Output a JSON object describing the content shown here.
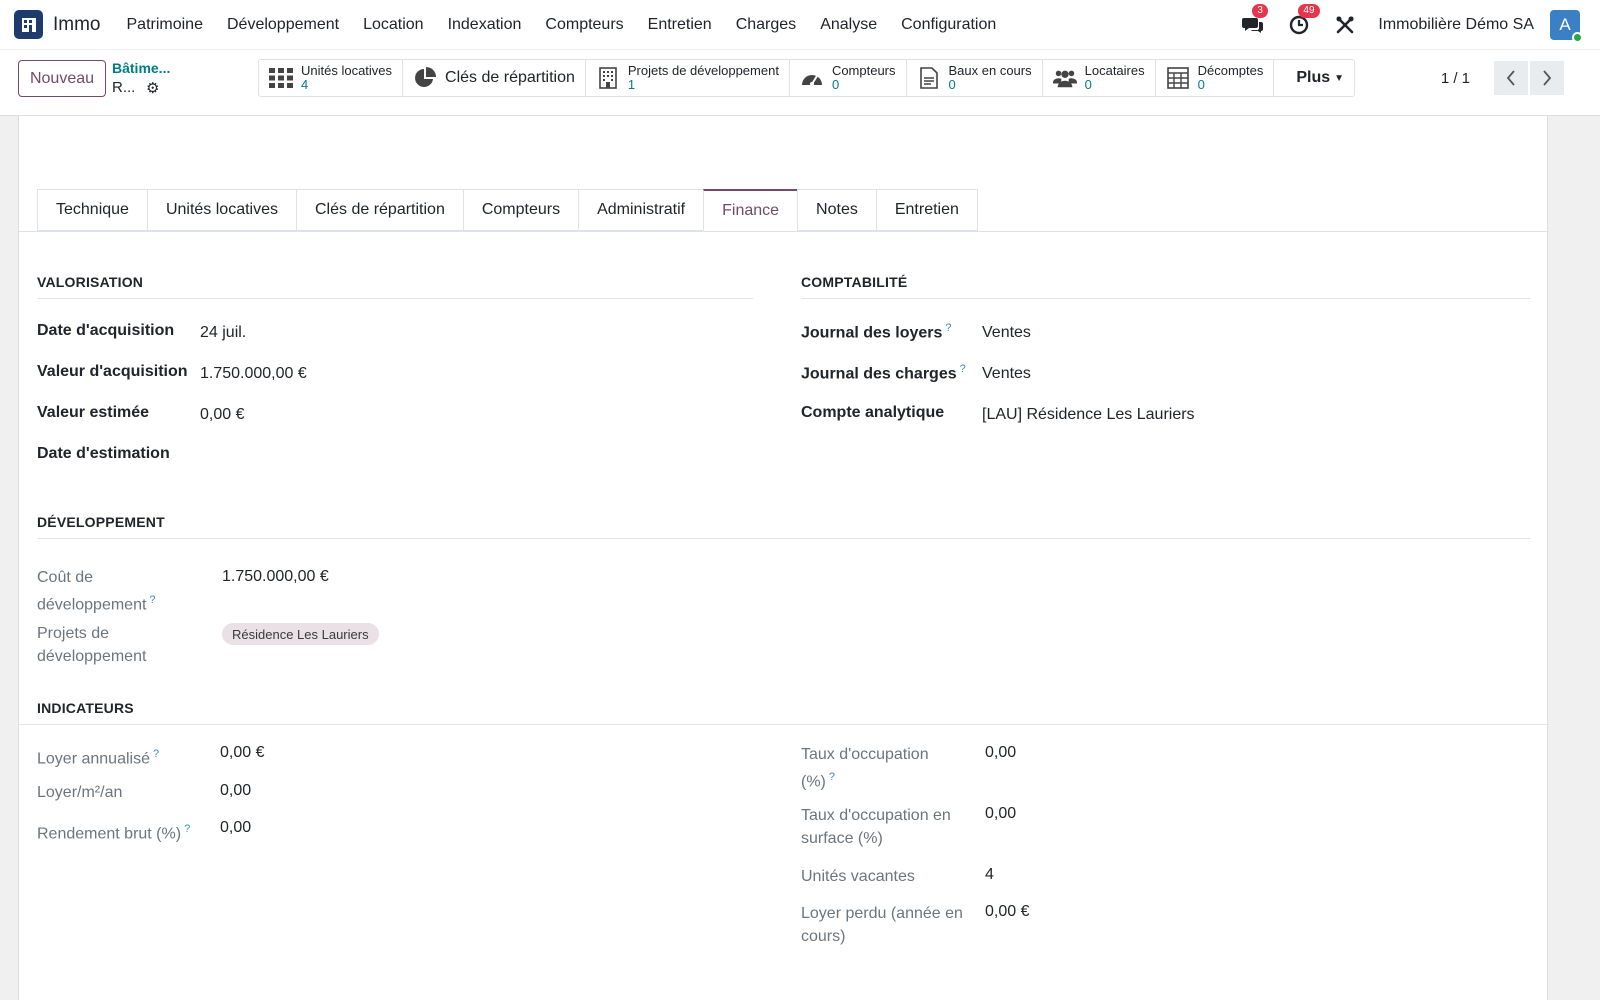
{
  "navbar": {
    "app_name": "Immo",
    "menu": [
      "Patrimoine",
      "Développement",
      "Location",
      "Indexation",
      "Compteurs",
      "Entretien",
      "Charges",
      "Analyse",
      "Configuration"
    ],
    "messages_count": "3",
    "activities_count": "49",
    "company": "Immobilière Démo SA",
    "avatar_letter": "A"
  },
  "control": {
    "new_label": "Nouveau",
    "breadcrumb_parent": "Bâtime...",
    "breadcrumb_current": "R...",
    "pager": "1 / 1",
    "smart_buttons": [
      {
        "label": "Unités locatives",
        "value": "4",
        "icon": "grid-icon"
      },
      {
        "label": "Clés de répartition",
        "value": null,
        "icon": "pie-chart-icon"
      },
      {
        "label": "Projets de développement",
        "value": "1",
        "icon": "building-icon"
      },
      {
        "label": "Compteurs",
        "value": "0",
        "icon": "gauge-icon"
      },
      {
        "label": "Baux en cours",
        "value": "0",
        "icon": "document-icon"
      },
      {
        "label": "Locataires",
        "value": "0",
        "icon": "users-icon"
      },
      {
        "label": "Décomptes",
        "value": "0",
        "icon": "calculator-icon"
      }
    ],
    "more_label": "Plus"
  },
  "tabs": [
    "Technique",
    "Unités locatives",
    "Clés de répartition",
    "Compteurs",
    "Administratif",
    "Finance",
    "Notes",
    "Entretien"
  ],
  "active_tab": "Finance",
  "valorisation": {
    "title": "VALORISATION",
    "acq_date_label": "Date d'acquisition",
    "acq_date_value": "24 juil.",
    "acq_value_label": "Valeur d'acquisition",
    "acq_value_value": "1.750.000,00 €",
    "est_value_label": "Valeur estimée",
    "est_value_value": "0,00 €",
    "est_date_label": "Date d'estimation"
  },
  "comptabilite": {
    "title": "COMPTABILITÉ",
    "rent_journal_label": "Journal des loyers",
    "rent_journal_value": "Ventes",
    "charges_journal_label": "Journal des charges",
    "charges_journal_value": "Ventes",
    "analytic_label": "Compte analytique",
    "analytic_value": "[LAU] Résidence Les Lauriers"
  },
  "developpement": {
    "title": "DÉVELOPPEMENT",
    "cost_label_1": "Coût de",
    "cost_label_2": "développement",
    "cost_value": "1.750.000,00 €",
    "projects_label_1": "Projets de",
    "projects_label_2": "développement",
    "project_tag": "Résidence Les Lauriers"
  },
  "indicateurs": {
    "title": "INDICATEURS",
    "annual_rent_label": "Loyer annualisé",
    "annual_rent_value": "0,00 €",
    "rent_m2_label": "Loyer/m²/an",
    "rent_m2_value": "0,00",
    "gross_yield_label": "Rendement brut (%)",
    "gross_yield_value": "0,00",
    "occupancy_label_1": "Taux d'occupation",
    "occupancy_label_2": "(%)",
    "occupancy_value": "0,00",
    "occupancy_surface_label_1": "Taux d'occupation en",
    "occupancy_surface_label_2": "surface (%)",
    "occupancy_surface_value": "0,00",
    "vacant_units_label": "Unités vacantes",
    "vacant_units_value": "4",
    "lost_rent_label_1": "Loyer perdu (année en",
    "lost_rent_label_2": "cours)",
    "lost_rent_value": "0,00 €"
  },
  "help_mark": "?"
}
